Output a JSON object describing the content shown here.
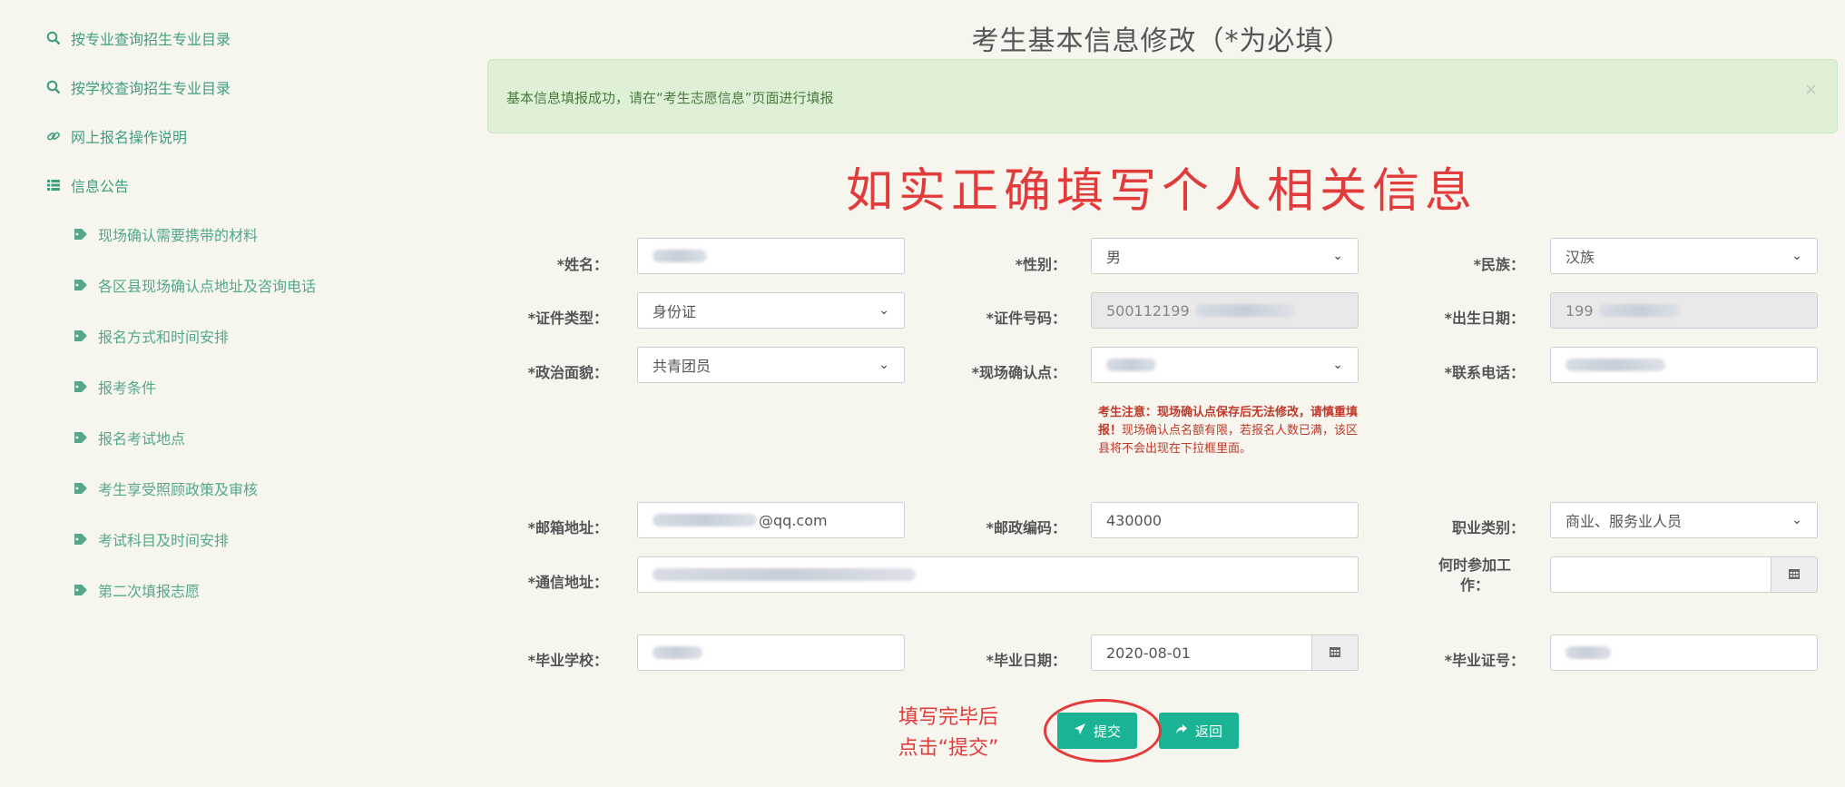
{
  "sidebar": {
    "items": [
      {
        "label": "按专业查询招生专业目录",
        "icon": "search-icon"
      },
      {
        "label": "按学校查询招生专业目录",
        "icon": "search-icon"
      },
      {
        "label": "网上报名操作说明",
        "icon": "link-icon"
      },
      {
        "label": "信息公告",
        "icon": "list-icon"
      }
    ],
    "subitems": [
      {
        "label": "现场确认需要携带的材料",
        "icon": "tag-icon"
      },
      {
        "label": "各区县现场确认点地址及咨询电话",
        "icon": "tag-icon"
      },
      {
        "label": "报名方式和时间安排",
        "icon": "tag-icon"
      },
      {
        "label": "报考条件",
        "icon": "tag-icon"
      },
      {
        "label": "报名考试地点",
        "icon": "tag-icon"
      },
      {
        "label": "考生享受照顾政策及审核",
        "icon": "tag-icon"
      },
      {
        "label": "考试科目及时间安排",
        "icon": "tag-icon"
      },
      {
        "label": "第二次填报志愿",
        "icon": "tag-icon"
      }
    ]
  },
  "page": {
    "title": "考生基本信息修改（*为必填）",
    "alert_text": "基本信息填报成功，请在“考生志愿信息”页面进行填报",
    "alert_close": "×",
    "red_heading": "如实正确填写个人相关信息"
  },
  "form": {
    "name_label": "*姓名：",
    "gender_label": "*性别：",
    "gender_value": "男",
    "ethnicity_label": "*民族：",
    "ethnicity_value": "汉族",
    "id_type_label": "*证件类型：",
    "id_type_value": "身份证",
    "id_number_label": "*证件号码：",
    "id_number_value": "500112199",
    "birth_label": "*出生日期：",
    "birth_value": "199",
    "political_label": "*政治面貌：",
    "political_value": "共青团员",
    "site_label": "*现场确认点：",
    "phone_label": "*联系电话：",
    "site_note_bold": "考生注意：现场确认点保存后无法修改，请慎重填报！",
    "site_note_rest": "现场确认点名额有限，若报名人数已满，该区县将不会出现在下拉框里面。",
    "email_label": "*邮箱地址：",
    "email_value": "@qq.com",
    "postcode_label": "*邮政编码：",
    "postcode_value": "430000",
    "occupation_label": "职业类别：",
    "occupation_value": "商业、服务业人员",
    "address_label": "*通信地址：",
    "work_start_label": "何时参加工作：",
    "school_label": "*毕业学校：",
    "grad_date_label": "*毕业日期：",
    "grad_date_value": "2020-08-01",
    "cert_label": "*毕业证号："
  },
  "actions": {
    "submit_label": "提交",
    "back_label": "返回",
    "hint_line1": "填写完毕后",
    "hint_line2": "点击“提交”"
  },
  "colors": {
    "accent": "#1ab394",
    "link": "#3f9e7c",
    "alert_bg": "#def1d7",
    "annotation_red": "#e23b3b"
  }
}
